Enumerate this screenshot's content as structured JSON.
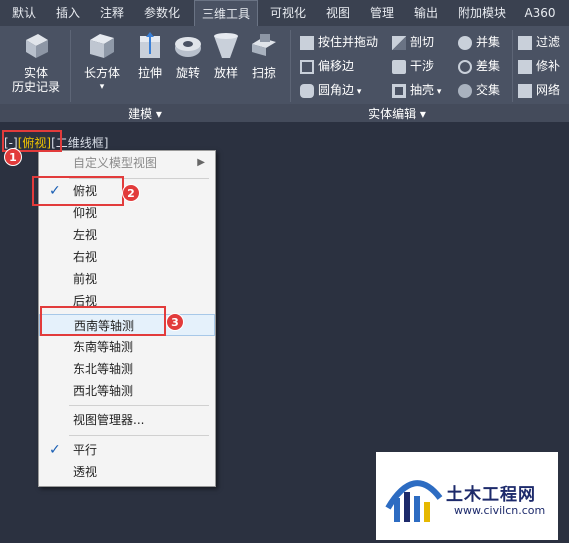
{
  "tabs": [
    "默认",
    "插入",
    "注释",
    "参数化",
    "三维工具",
    "可视化",
    "视图",
    "管理",
    "输出",
    "附加模块",
    "A360"
  ],
  "active_tab": "三维工具",
  "ribbon": {
    "history": [
      "实体",
      "历史记录"
    ],
    "box": "长方体",
    "extrude": "拉伸",
    "revolve": "旋转",
    "loft": "放样",
    "sweep": "扫掠",
    "drag": "按住并拖动",
    "offset_edge": "偏移边",
    "fillet_edge": "圆角边",
    "slice": "剖切",
    "interfere": "干涉",
    "shell": "抽壳",
    "union": "并集",
    "subtract": "差集",
    "intersect": "交集",
    "filter": "过滤",
    "repair": "修补",
    "mesh": "网络",
    "group_model": "建模",
    "group_solid": "实体编辑"
  },
  "viewport_label": {
    "minus": "[-]",
    "view": "[俯视]",
    "style": "[二维线框]"
  },
  "menu": {
    "custom": "自定义模型视图",
    "views": [
      "俯视",
      "仰视",
      "左视",
      "右视",
      "前视",
      "后视"
    ],
    "iso": [
      "西南等轴测",
      "东南等轴测",
      "东北等轴测",
      "西北等轴测"
    ],
    "manager": "视图管理器...",
    "parallel": "平行",
    "perspective": "透视",
    "check": "✓"
  },
  "badges": [
    "1",
    "2",
    "3"
  ],
  "watermark": {
    "title": "土木工程网",
    "url": "www.civilcn.com"
  },
  "colors": {
    "accent": "#e23b3b",
    "highlight": "#f0c400"
  }
}
